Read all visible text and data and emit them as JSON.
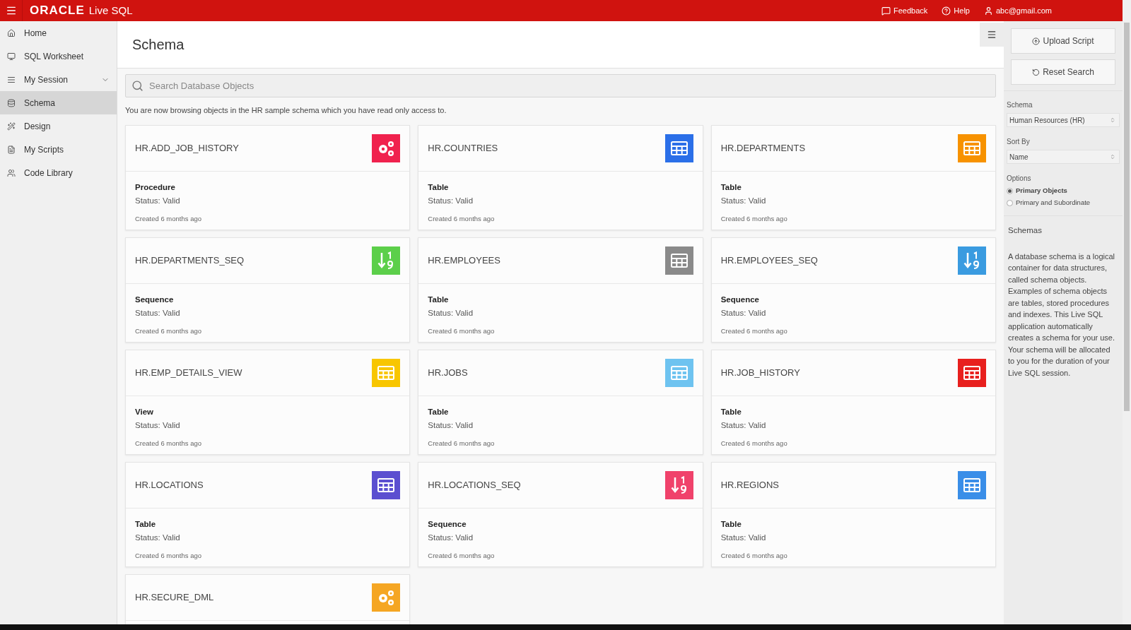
{
  "header": {
    "logo": "ORACLE",
    "product": "Live SQL",
    "links": [
      {
        "label": "Feedback"
      },
      {
        "label": "Help"
      },
      {
        "label": "abc@gmail.com"
      }
    ]
  },
  "sidebar": {
    "items": [
      {
        "label": "Home",
        "selected": false
      },
      {
        "label": "SQL Worksheet",
        "selected": false
      },
      {
        "label": "My Session",
        "selected": false,
        "expanded": false
      },
      {
        "label": "Schema",
        "selected": true
      },
      {
        "label": "Design",
        "selected": false
      },
      {
        "label": "My Scripts",
        "selected": false
      },
      {
        "label": "Code Library",
        "selected": false
      }
    ]
  },
  "page": {
    "title": "Schema",
    "search": {
      "placeholder": "Search Database Objects"
    },
    "notice": "You are now browsing objects in the HR sample schema which you have read only access to."
  },
  "cards": [
    {
      "name": "HR.ADD_JOB_HISTORY",
      "kind": "procedure",
      "color": "#f0224e",
      "type": "Procedure",
      "status": "Status: Valid",
      "created": "Created 6 months ago"
    },
    {
      "name": "HR.COUNTRIES",
      "kind": "table",
      "color": "#2b6fe8",
      "type": "Table",
      "status": "Status: Valid",
      "created": "Created 6 months ago"
    },
    {
      "name": "HR.DEPARTMENTS",
      "kind": "table",
      "color": "#f79200",
      "type": "Table",
      "status": "Status: Valid",
      "created": "Created 6 months ago"
    },
    {
      "name": "HR.DEPARTMENTS_SEQ",
      "kind": "sequence",
      "color": "#5ccf4a",
      "type": "Sequence",
      "status": "Status: Valid",
      "created": "Created 6 months ago"
    },
    {
      "name": "HR.EMPLOYEES",
      "kind": "table",
      "color": "#8a8a8a",
      "type": "Table",
      "status": "Status: Valid",
      "created": "Created 6 months ago"
    },
    {
      "name": "HR.EMPLOYEES_SEQ",
      "kind": "sequence",
      "color": "#3a9be0",
      "type": "Sequence",
      "status": "Status: Valid",
      "created": "Created 6 months ago"
    },
    {
      "name": "HR.EMP_DETAILS_VIEW",
      "kind": "table",
      "color": "#f8c600",
      "type": "View",
      "status": "Status: Valid",
      "created": "Created 6 months ago"
    },
    {
      "name": "HR.JOBS",
      "kind": "table",
      "color": "#6ec3f0",
      "type": "Table",
      "status": "Status: Valid",
      "created": "Created 6 months ago"
    },
    {
      "name": "HR.JOB_HISTORY",
      "kind": "table",
      "color": "#e8201e",
      "type": "Table",
      "status": "Status: Valid",
      "created": "Created 6 months ago"
    },
    {
      "name": "HR.LOCATIONS",
      "kind": "table",
      "color": "#5b4fd0",
      "type": "Table",
      "status": "Status: Valid",
      "created": "Created 6 months ago"
    },
    {
      "name": "HR.LOCATIONS_SEQ",
      "kind": "sequence",
      "color": "#f0426b",
      "type": "Sequence",
      "status": "Status: Valid",
      "created": "Created 6 months ago"
    },
    {
      "name": "HR.REGIONS",
      "kind": "table",
      "color": "#3a8ee8",
      "type": "Table",
      "status": "Status: Valid",
      "created": "Created 6 months ago"
    },
    {
      "name": "HR.SECURE_DML",
      "kind": "procedure",
      "color": "#f5a623"
    }
  ],
  "right_panel": {
    "buttons": [
      {
        "label": "Upload Script"
      },
      {
        "label": "Reset Search"
      }
    ],
    "schema": {
      "label": "Schema",
      "value": "Human Resources (HR)"
    },
    "sort_by": {
      "label": "Sort By",
      "value": "Name"
    },
    "options": {
      "label": "Options",
      "items": [
        {
          "label": "Primary Objects",
          "selected": true
        },
        {
          "label": "Primary and Subordinate",
          "selected": false
        }
      ]
    },
    "info": {
      "title": "Schemas",
      "text": "A database schema is a logical container for data structures, called schema objects. Examples of schema objects are tables, stored procedures and indexes. This Live SQL application automatically creates a schema for your use. Your schema will be allocated to you for the duration of your Live SQL session."
    }
  }
}
